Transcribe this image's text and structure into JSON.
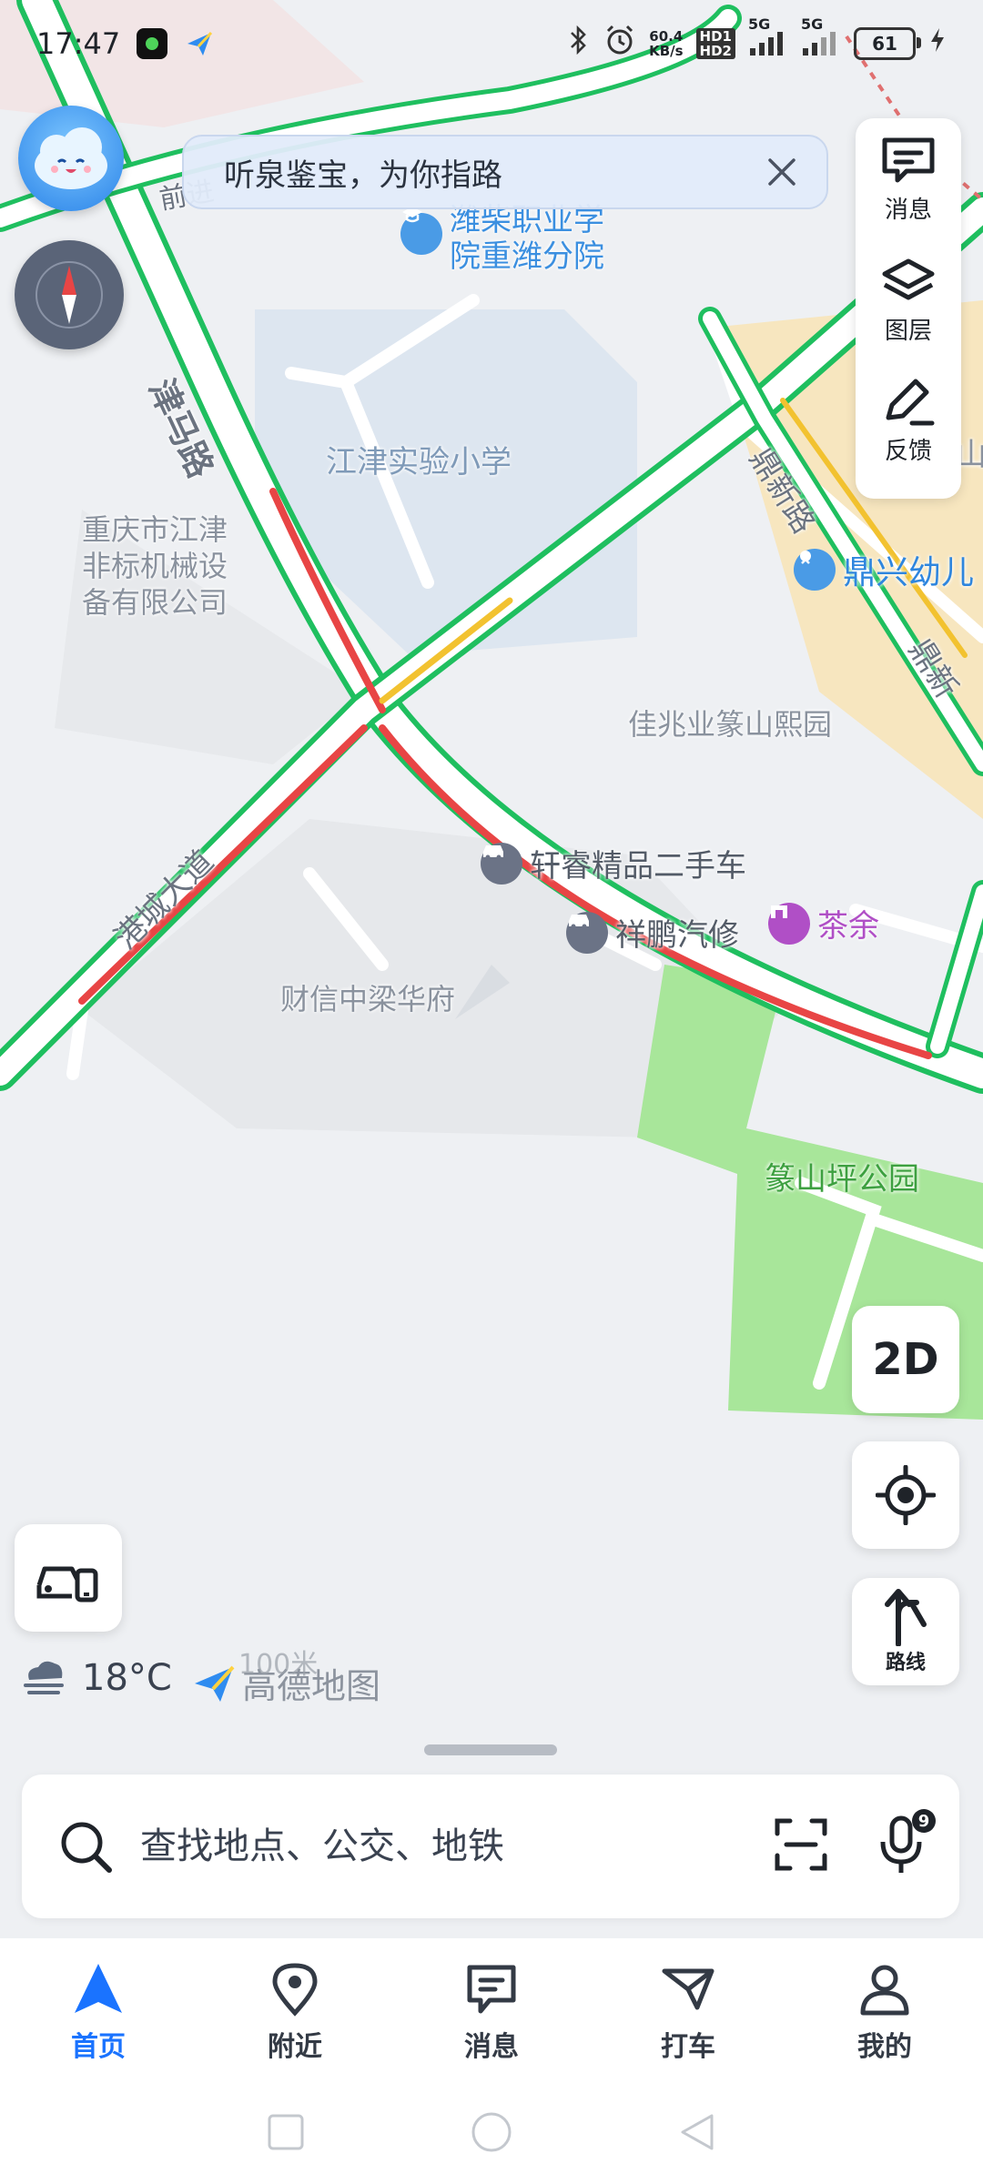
{
  "status_bar": {
    "time": "17:47",
    "net_speed_value": "60.4",
    "net_speed_unit": "KB/s",
    "hd1": "HD1",
    "hd2": "HD2",
    "sim1": "5G",
    "sim2": "5G",
    "battery": "61"
  },
  "tip_banner": {
    "text": "听泉鉴宝，为你指路"
  },
  "right_panel": {
    "messages_label": "消息",
    "layers_label": "图层",
    "feedback_label": "反馈"
  },
  "map": {
    "roads": {
      "jinma": "津马路",
      "dingxin": "鼎新路",
      "dingxin_2": "鼎新",
      "gangcheng": "港城大道",
      "top_left_partial": "前进"
    },
    "places": {
      "school_poi": "潍柴职业学院重潍分院",
      "school_poi_line1": "潍柴职业学",
      "school_poi_line2": "院重潍分院",
      "primary_school": "江津实验小学",
      "company_line1": "重庆市江津",
      "company_line2": "非标机械设",
      "company_line3": "备有限公司",
      "kindergarten": "鼎兴幼儿园",
      "kindergarten_visible": "鼎兴幼儿",
      "jiazhao": "佳兆业篆山熙园",
      "used_car": "轩睿精品二手车",
      "repair": "祥鹏汽修",
      "teahouse": "茶余",
      "caixin": "财信中梁华府",
      "park": "篆山坪公园",
      "right_edge": "山"
    }
  },
  "controls": {
    "view_mode": "2D",
    "route_label": "路线"
  },
  "weather": {
    "temperature": "18°C"
  },
  "scale": {
    "distance": "100米",
    "brand": "高德地图"
  },
  "search": {
    "placeholder": "查找地点、公交、地铁",
    "voice_badge": "9"
  },
  "tabs": [
    {
      "label": "首页"
    },
    {
      "label": "附近"
    },
    {
      "label": "消息"
    },
    {
      "label": "打车"
    },
    {
      "label": "我的"
    }
  ],
  "colors": {
    "accent": "#1a73ff",
    "traffic_smooth": "#1fbf5f",
    "traffic_congested": "#e84545",
    "traffic_slow": "#f2c230",
    "park_green": "#a8e69a"
  }
}
